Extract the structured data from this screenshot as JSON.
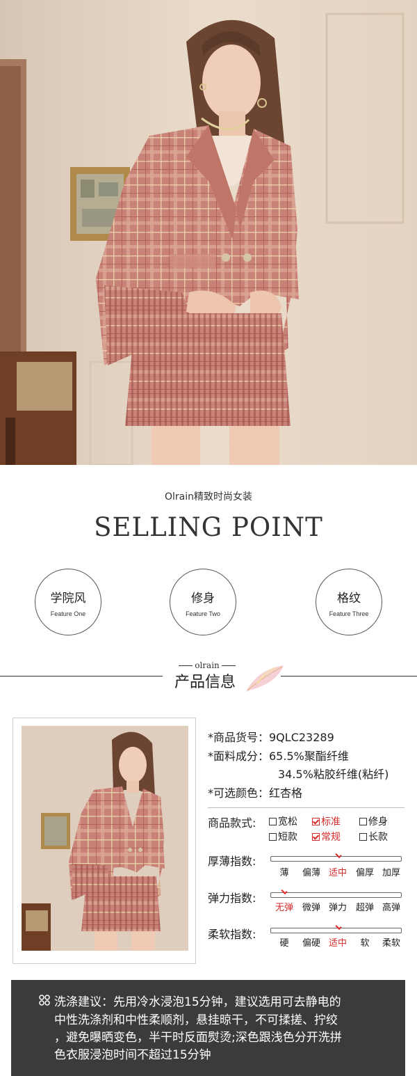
{
  "brand_line": "Olrain精致时尚女装",
  "selling_point_title": "SELLING POINT",
  "features": [
    {
      "cn": "学院风",
      "en": "Feature One"
    },
    {
      "cn": "修身",
      "en": "Feature Two"
    },
    {
      "cn": "格纹",
      "en": "Feature Three"
    }
  ],
  "section": {
    "brand_mark": "olrain",
    "title": "产品信息"
  },
  "specs": {
    "item_no": "*商品货号：9QLC23289",
    "fabric": "*面料成分：65.5%聚酯纤维",
    "fabric_2": "34.5%粘胶纤维(粘纤)",
    "color": "*可选颜色：红杏格"
  },
  "style": {
    "label": "商品款式:",
    "options": [
      {
        "text": "宽松",
        "checked": false
      },
      {
        "text": "标准",
        "checked": true
      },
      {
        "text": "修身",
        "checked": false
      },
      {
        "text": "短款",
        "checked": false
      },
      {
        "text": "常规",
        "checked": true
      },
      {
        "text": "长款",
        "checked": false
      }
    ]
  },
  "scales": [
    {
      "label": "厚薄指数:",
      "ticks": [
        "薄",
        "偏薄",
        "适中",
        "偏厚",
        "加厚"
      ],
      "selected": 2
    },
    {
      "label": "弹力指数:",
      "ticks": [
        "无弹",
        "微弹",
        "弹力",
        "超弹",
        "高弹"
      ],
      "selected": 0
    },
    {
      "label": "柔软指数:",
      "ticks": [
        "硬",
        "偏硬",
        "适中",
        "软",
        "柔软"
      ],
      "selected": 2
    }
  ],
  "wash": {
    "icon": "wash-care-icon",
    "lines": [
      "洗涤建议：先用冷水浸泡15分钟，建议选用可去静电的",
      "中性洗涤剂和中性柔顺剂，悬挂晾干，不可揉搓、拧绞",
      "，避免曝晒变色，半干时反面熨烫;深色跟浅色分开洗拼",
      "色衣服浸泡时间不超过15分钟"
    ]
  },
  "colors": {
    "accent_red": "#d62b2b",
    "wash_bg": "#3b3b3b",
    "plaid": "#c97d72"
  }
}
